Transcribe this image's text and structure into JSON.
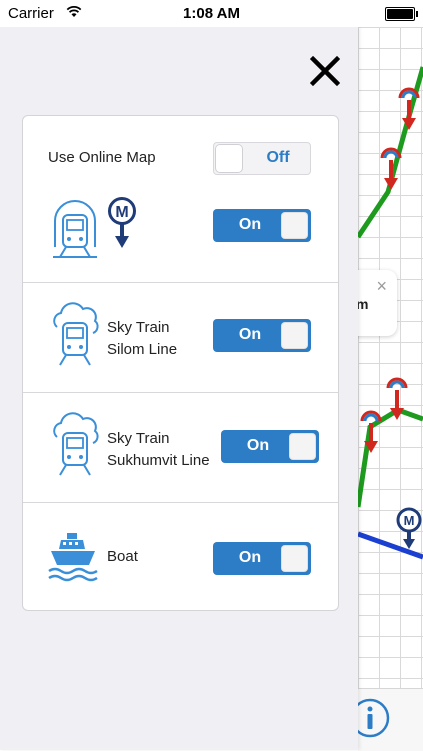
{
  "status_bar": {
    "carrier": "Carrier",
    "time": "1:08 AM"
  },
  "drawer": {
    "close_label": "X",
    "online_map": {
      "label": "Use Online Map",
      "toggle": "Off"
    },
    "metro": {
      "icon": "train-tower-icon",
      "badge_icon": "metro-m-icon",
      "toggle": "On"
    },
    "sky_silom": {
      "label_line1": "Sky Train",
      "label_line2": "Silom Line",
      "icon": "sky-train-cloud-icon",
      "toggle": "On"
    },
    "sky_sukhumvit": {
      "label_line1": "Sky Train",
      "label_line2": "Sukhumvit Line",
      "icon": "sky-train-cloud-icon",
      "toggle": "On"
    },
    "boat": {
      "label": "Boat",
      "icon": "boat-icon",
      "toggle": "On"
    }
  },
  "map": {
    "popup_text": "m",
    "popup_close": "×",
    "info_icon": "info-icon"
  },
  "colors": {
    "accent_blue": "#2c7dc6",
    "icon_blue": "#3a8fd8",
    "metro_navy": "#1f3c78",
    "green_line": "#1e9a1e",
    "blue_line": "#1b3fd0",
    "red_marker": "#d0281e"
  }
}
